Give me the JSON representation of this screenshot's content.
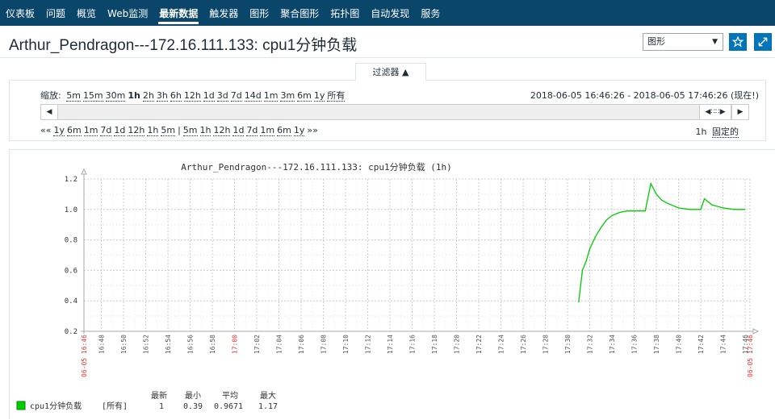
{
  "nav": {
    "items": [
      "仪表板",
      "问题",
      "概览",
      "Web监测",
      "最新数据",
      "触发器",
      "图形",
      "聚合图形",
      "拓扑图",
      "自动发现",
      "服务"
    ],
    "active_index": 4
  },
  "header": {
    "title": "Arthur_Pendragon---172.16.111.133: cpu1分钟负载",
    "view_select": "图形",
    "favorite_icon": "star-icon",
    "fullscreen_icon": "fullscreen-icon"
  },
  "filter": {
    "tab_label": "过滤器 ▲",
    "zoom_label": "缩放:",
    "zoom_options": [
      "5m",
      "15m",
      "30m",
      "1h",
      "2h",
      "3h",
      "6h",
      "12h",
      "1d",
      "3d",
      "7d",
      "14d",
      "1m",
      "3m",
      "6m",
      "1y",
      "所有"
    ],
    "zoom_selected": "1h",
    "range_text": "2018-06-05 16:46:26 - 2018-06-05 17:46:26 (现在!)",
    "back_prefix": "««",
    "back_options": [
      "1y",
      "6m",
      "1m",
      "7d",
      "1d",
      "12h",
      "1h",
      "5m"
    ],
    "separator": "|",
    "fwd_options": [
      "5m",
      "1h",
      "12h",
      "1d",
      "7d",
      "1m",
      "6m",
      "1y"
    ],
    "fwd_suffix": "»»",
    "period_value": "1h",
    "fixed_label": "固定的"
  },
  "chart_data": {
    "type": "line",
    "title": "Arthur_Pendragon---172.16.111.133: cpu1分钟负载 (1h)",
    "ylim": [
      0.2,
      1.2
    ],
    "y_ticks": [
      "0.2",
      "0.4",
      "0.6",
      "0.8",
      "1.0",
      "1.2"
    ],
    "x_tick_labels": [
      "06-05 16:46",
      "16:48",
      "16:50",
      "16:52",
      "16:54",
      "16:56",
      "16:58",
      "17:00",
      "17:02",
      "17:04",
      "17:06",
      "17:08",
      "17:10",
      "17:12",
      "17:14",
      "17:16",
      "17:18",
      "17:20",
      "17:22",
      "17:24",
      "17:26",
      "17:28",
      "17:30",
      "17:32",
      "17:34",
      "17:36",
      "17:38",
      "17:40",
      "17:42",
      "17:44",
      "17:46",
      "06-05 17:46"
    ],
    "x_tick_red": [
      "06-05 16:46",
      "17:00",
      "06-05 17:46"
    ],
    "series": [
      {
        "name": "cpu1分钟负载",
        "color": "#00cc00",
        "points": [
          [
            "17:31:00",
            0.39
          ],
          [
            "17:31:20",
            0.6
          ],
          [
            "17:31:40",
            0.66
          ],
          [
            "17:32:00",
            0.74
          ],
          [
            "17:32:30",
            0.82
          ],
          [
            "17:33:00",
            0.88
          ],
          [
            "17:33:30",
            0.93
          ],
          [
            "17:34:00",
            0.96
          ],
          [
            "17:34:40",
            0.98
          ],
          [
            "17:35:20",
            0.99
          ],
          [
            "17:36:00",
            0.99
          ],
          [
            "17:37:00",
            0.99
          ],
          [
            "17:37:30",
            1.17
          ],
          [
            "17:38:00",
            1.1
          ],
          [
            "17:38:30",
            1.06
          ],
          [
            "17:39:00",
            1.04
          ],
          [
            "17:40:00",
            1.01
          ],
          [
            "17:41:00",
            1.0
          ],
          [
            "17:42:00",
            1.0
          ],
          [
            "17:42:20",
            1.07
          ],
          [
            "17:43:00",
            1.03
          ],
          [
            "17:44:00",
            1.01
          ],
          [
            "17:45:00",
            1.0
          ],
          [
            "17:46:00",
            1.0
          ]
        ]
      }
    ],
    "legend": {
      "headers": [
        "最新",
        "最小",
        "平均",
        "最大"
      ],
      "rows": [
        {
          "name": "cpu1分钟负载",
          "func": "[所有]",
          "values": [
            "1",
            "0.39",
            "0.9671",
            "1.17"
          ]
        }
      ]
    }
  }
}
